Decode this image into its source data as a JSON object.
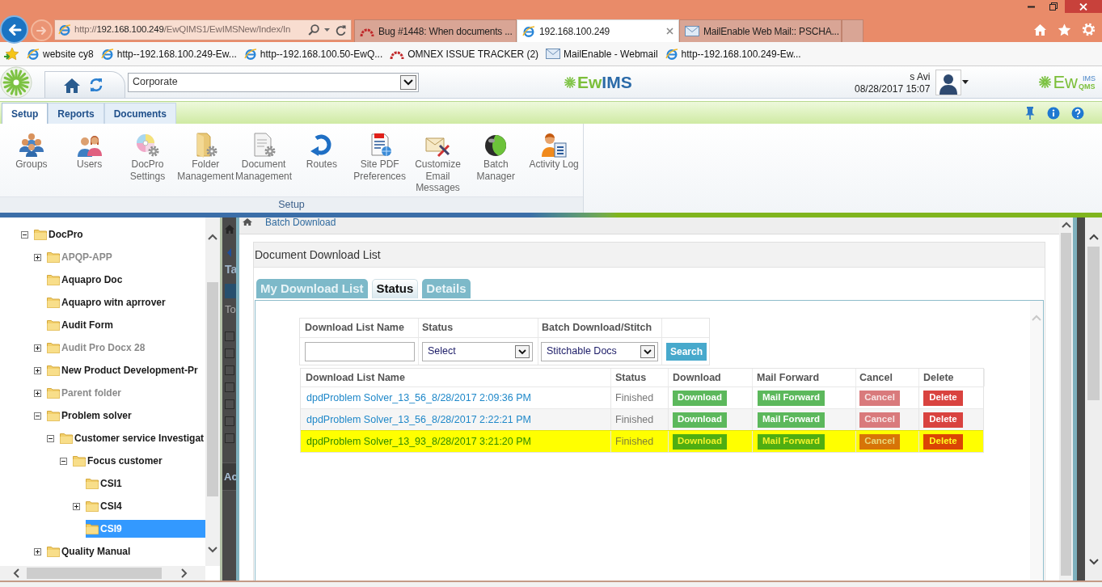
{
  "browser": {
    "address": {
      "scheme": "http://",
      "host": "192.168.100.249",
      "path": "/EwQIMS1/EwIMSNew/Index/In"
    },
    "tabs": [
      {
        "title": "Bug #1448: When documents ...",
        "kind": "tracker",
        "selected": false
      },
      {
        "title": "192.168.100.249",
        "kind": "ie",
        "selected": true
      },
      {
        "title": "MailEnable Web Mail:: PSCHA...",
        "kind": "mail",
        "selected": false
      }
    ],
    "favorites": [
      {
        "label": "website cy8",
        "kind": "ie"
      },
      {
        "label": "http--192.168.100.249-Ew...",
        "kind": "ie"
      },
      {
        "label": "http--192.168.100.50-EwQ...",
        "kind": "ie"
      },
      {
        "label": "OMNEX ISSUE TRACKER (2)",
        "kind": "tracker"
      },
      {
        "label": "MailEnable - Webmail",
        "kind": "mail"
      },
      {
        "label": "http--192.168.100.249-Ew...",
        "kind": "ie"
      }
    ]
  },
  "app_header": {
    "site": "Corporate",
    "brand": {
      "first": "Ew",
      "second": "IMS"
    },
    "user": "s Avi",
    "datetime": "08/28/2017 15:07",
    "product_logo": {
      "main": "Ew",
      "upper": "IMS",
      "lower": "QMS"
    }
  },
  "ribbon": {
    "tabs": [
      {
        "label": "Setup",
        "selected": true
      },
      {
        "label": "Reports",
        "selected": false
      },
      {
        "label": "Documents",
        "selected": false
      }
    ],
    "items": [
      {
        "label": "Groups",
        "kind": "groups"
      },
      {
        "label": "Users",
        "kind": "users"
      },
      {
        "label": "DocPro Settings",
        "kind": "disc"
      },
      {
        "label": "Folder Management",
        "kind": "folder"
      },
      {
        "label": "Document Management",
        "kind": "document"
      },
      {
        "label": "Routes",
        "kind": "routes"
      },
      {
        "label": "Site PDF Preferences",
        "kind": "pdf"
      },
      {
        "label": "Customize Email Messages",
        "kind": "email"
      },
      {
        "label": "Batch Manager",
        "kind": "batch"
      },
      {
        "label": "Activity Log",
        "kind": "log"
      }
    ],
    "group": "Setup"
  },
  "tree": {
    "items": [
      {
        "label": "DocPro",
        "kind": "branch",
        "expanded": true,
        "selected": false,
        "disabled": false,
        "children": [
          {
            "label": "APQP-APP",
            "kind": "branch",
            "expanded": false,
            "selected": false,
            "disabled": true
          },
          {
            "label": "Aquapro Doc",
            "kind": "leaf",
            "selected": false,
            "disabled": false
          },
          {
            "label": "Aquapro witn aprrover",
            "kind": "leaf",
            "selected": false,
            "disabled": false
          },
          {
            "label": "Audit Form",
            "kind": "leaf",
            "selected": false,
            "disabled": false
          },
          {
            "label": "Audit Pro Docx 28",
            "kind": "branch",
            "expanded": false,
            "selected": false,
            "disabled": true
          },
          {
            "label": "New Product Development-Pr",
            "kind": "branch",
            "expanded": false,
            "selected": false,
            "disabled": false
          },
          {
            "label": "Parent folder",
            "kind": "branch",
            "expanded": false,
            "selected": false,
            "disabled": true
          },
          {
            "label": "Problem solver",
            "kind": "branch",
            "expanded": true,
            "selected": false,
            "disabled": false,
            "children": [
              {
                "label": "Customer service Investigat",
                "kind": "branch",
                "expanded": true,
                "selected": false,
                "disabled": false,
                "children": [
                  {
                    "label": "Focus customer",
                    "kind": "branch",
                    "expanded": true,
                    "selected": false,
                    "disabled": false,
                    "children": [
                      {
                        "label": "CSI1",
                        "kind": "leaf",
                        "selected": false,
                        "disabled": false
                      },
                      {
                        "label": "CSI4",
                        "kind": "branch",
                        "expanded": false,
                        "selected": false,
                        "disabled": false
                      },
                      {
                        "label": "CSI9",
                        "kind": "leaf",
                        "selected": true,
                        "disabled": false
                      }
                    ]
                  }
                ]
              }
            ]
          },
          {
            "label": "Quality Manual",
            "kind": "branch",
            "expanded": false,
            "selected": false,
            "disabled": false
          }
        ]
      }
    ]
  },
  "background_page": {
    "title": "Ta",
    "label": "To",
    "section": "Ac",
    "checkboxes": [
      {
        "checked": false
      },
      {
        "checked": false
      },
      {
        "checked": false
      },
      {
        "checked": false
      },
      {
        "checked": false
      },
      {
        "checked": false
      },
      {
        "checked": false
      }
    ]
  },
  "dialog": {
    "breadcrumb": "Batch Download",
    "title": "Document Download List",
    "tabs": [
      {
        "label": "My Download List",
        "selected": false
      },
      {
        "label": "Status",
        "selected": true
      },
      {
        "label": "Details",
        "selected": false
      }
    ],
    "filters": {
      "columns": [
        "Download List Name",
        "Status",
        "Batch Download/Stitch"
      ],
      "status_select": "Select",
      "batch_select": "Stitchable Docs",
      "search_button": "Search"
    },
    "results": {
      "columns": [
        "Download List Name",
        "Status",
        "Download",
        "Mail Forward",
        "Cancel",
        "Delete"
      ],
      "rows": [
        {
          "name": "dpdProblem Solver_13_56_8/28/2017 2:09:36 PM",
          "status": "Finished",
          "selected": false,
          "download": "Download",
          "mail_forward": "Mail Forward",
          "cancel": {
            "label": "Cancel",
            "disabled": true
          },
          "delete": "Delete"
        },
        {
          "name": "dpdProblem Solver_13_56_8/28/2017 2:22:21 PM",
          "status": "Finished",
          "selected": false,
          "download": "Download",
          "mail_forward": "Mail Forward",
          "cancel": {
            "label": "Cancel",
            "disabled": true
          },
          "delete": "Delete"
        },
        {
          "name": "dpdProblem Solver_13_93_8/28/2017 3:21:20 PM",
          "status": "Finished",
          "selected": true,
          "download": "Download",
          "mail_forward": "Mail Forward",
          "cancel": {
            "label": "Cancel",
            "disabled": true
          },
          "delete": "Delete"
        }
      ]
    }
  }
}
